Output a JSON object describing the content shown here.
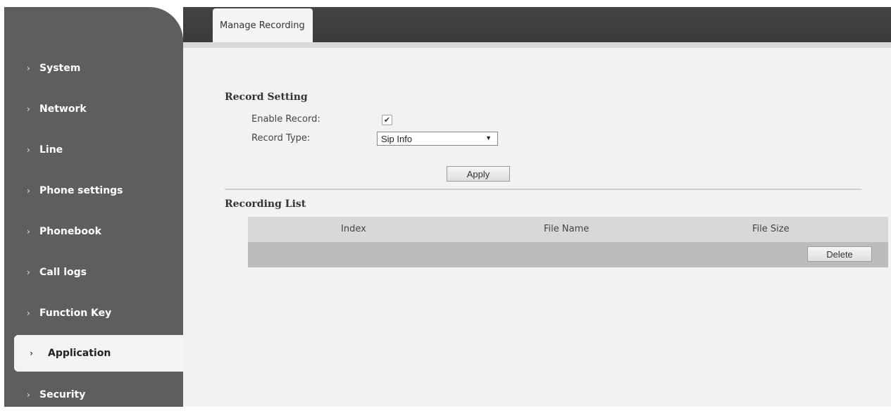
{
  "sidebar": {
    "items": [
      {
        "label": "System",
        "active": false
      },
      {
        "label": "Network",
        "active": false
      },
      {
        "label": "Line",
        "active": false
      },
      {
        "label": "Phone settings",
        "active": false
      },
      {
        "label": "Phonebook",
        "active": false
      },
      {
        "label": "Call logs",
        "active": false
      },
      {
        "label": "Function Key",
        "active": false
      },
      {
        "label": "Application",
        "active": true
      },
      {
        "label": "Security",
        "active": false
      }
    ],
    "chevron": "›"
  },
  "tabs": [
    {
      "label": "Manage Recording",
      "active": true
    }
  ],
  "record_setting": {
    "title": "Record Setting",
    "enable_record_label": "Enable Record:",
    "enable_record_checked": true,
    "checkmark": "✔",
    "record_type_label": "Record Type:",
    "record_type_value": "Sip Info",
    "dropdown_arrow": "▼",
    "apply_label": "Apply"
  },
  "recording_list": {
    "title": "Recording List",
    "columns": [
      "Index",
      "File Name",
      "File Size"
    ],
    "delete_label": "Delete"
  }
}
